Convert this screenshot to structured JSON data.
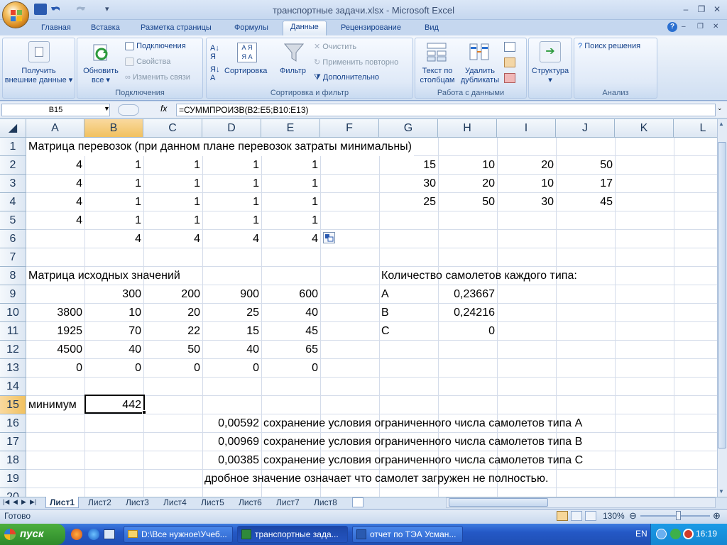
{
  "window": {
    "title": "транспортные задачи.xlsx - Microsoft Excel"
  },
  "ribbon": {
    "tabs": [
      "Главная",
      "Вставка",
      "Разметка страницы",
      "Формулы",
      "Данные",
      "Рецензирование",
      "Вид"
    ],
    "active_tab": "Данные",
    "groups": {
      "external": {
        "label_line1": "Получить",
        "label_line2": "внешние данные"
      },
      "connections": {
        "label": "Подключения",
        "refresh_line1": "Обновить",
        "refresh_line2": "все",
        "items": [
          "Подключения",
          "Свойства",
          "Изменить связи"
        ]
      },
      "sort_filter": {
        "label": "Сортировка и фильтр",
        "sort": "Сортировка",
        "filter": "Фильтр",
        "items": [
          "Очистить",
          "Применить повторно",
          "Дополнительно"
        ]
      },
      "data_tools": {
        "label": "Работа с данными",
        "text_cols_line1": "Текст по",
        "text_cols_line2": "столбцам",
        "dup_line1": "Удалить",
        "dup_line2": "дубликаты"
      },
      "outline": {
        "label": "Структура"
      },
      "analysis": {
        "label": "Анализ",
        "solver": "Поиск решения"
      }
    }
  },
  "formula_bar": {
    "name_box": "B15",
    "fx": "fx",
    "formula": "=СУММПРОИЗВ(B2:E5;B10:E13)"
  },
  "columns": [
    "A",
    "B",
    "C",
    "D",
    "E",
    "F",
    "G",
    "H",
    "I",
    "J",
    "K",
    "L"
  ],
  "rows": [
    "1",
    "2",
    "3",
    "4",
    "5",
    "6",
    "7",
    "8",
    "9",
    "10",
    "11",
    "12",
    "13",
    "14",
    "15",
    "16",
    "17",
    "18",
    "19",
    "20"
  ],
  "cells": {
    "A1": "Матрица перевозок (при данном плане перевозок затраты минимальны)",
    "A2": "4",
    "B2": "1",
    "C2": "1",
    "D2": "1",
    "E2": "1",
    "A3": "4",
    "B3": "1",
    "C3": "1",
    "D3": "1",
    "E3": "1",
    "A4": "4",
    "B4": "1",
    "C4": "1",
    "D4": "1",
    "E4": "1",
    "A5": "4",
    "B5": "1",
    "C5": "1",
    "D5": "1",
    "E5": "1",
    "B6": "4",
    "C6": "4",
    "D6": "4",
    "E6": "4",
    "G2": "15",
    "H2": "10",
    "I2": "20",
    "J2": "50",
    "G3": "30",
    "H3": "20",
    "I3": "10",
    "J3": "17",
    "G4": "25",
    "H4": "50",
    "I4": "30",
    "J4": "45",
    "A8": "Матрица исходных значений",
    "G8": "Количество самолетов каждого типа:",
    "B9": "300",
    "C9": "200",
    "D9": "900",
    "E9": "600",
    "G9": "A",
    "H9": "0,23667",
    "A10": "3800",
    "B10": "10",
    "C10": "20",
    "D10": "25",
    "E10": "40",
    "G10": "B",
    "H10": "0,24216",
    "A11": "1925",
    "B11": "70",
    "C11": "22",
    "D11": "15",
    "E11": "45",
    "G11": "C",
    "H11": "0",
    "A12": "4500",
    "B12": "40",
    "C12": "50",
    "D12": "40",
    "E12": "65",
    "A13": "0",
    "B13": "0",
    "C13": "0",
    "D13": "0",
    "E13": "0",
    "A15": "минимум",
    "B15": "442",
    "D16": "0,00592",
    "E16": "сохранение условия ограниченного числа самолетов типа A",
    "D17": "0,00969",
    "E17": "сохранение условия ограниченного числа самолетов типа B",
    "D18": "0,00385",
    "E18": "сохранение условия ограниченного числа самолетов типа C",
    "D19": "дробное значение означает что самолет загружен не полностью."
  },
  "sheets": [
    "Лист1",
    "Лист2",
    "Лист3",
    "Лист4",
    "Лист5",
    "Лист6",
    "Лист7",
    "Лист8"
  ],
  "active_sheet": "Лист1",
  "status": {
    "ready": "Готово",
    "zoom": "130%"
  },
  "taskbar": {
    "start": "пуск",
    "tasks": [
      "D:\\Все нужное\\Учеб...",
      "транспортные зада...",
      "отчет по ТЭА Усман..."
    ],
    "lang": "EN",
    "clock": "16:19"
  }
}
